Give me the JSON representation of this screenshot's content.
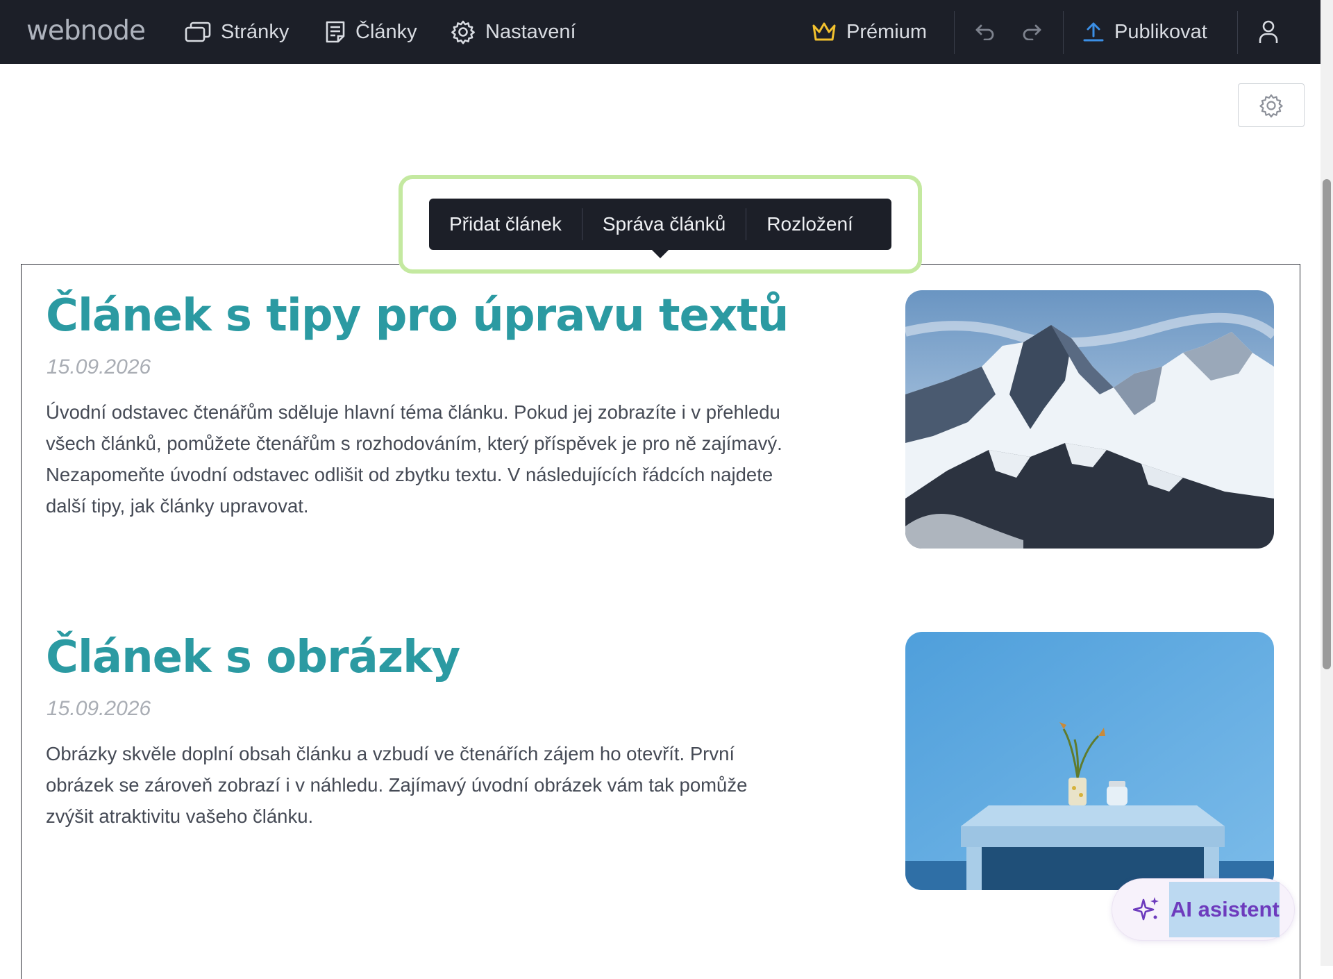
{
  "topbar": {
    "logo": "webnode",
    "nav": [
      {
        "label": "Stránky",
        "icon": "pages-icon"
      },
      {
        "label": "Články",
        "icon": "articles-icon"
      },
      {
        "label": "Nastavení",
        "icon": "gear-icon"
      }
    ],
    "premium_label": "Prémium",
    "publish_label": "Publikovat",
    "colors": {
      "bar": "#1c1f28",
      "crown": "#f2c12e",
      "publish_icon": "#3b8fe6"
    }
  },
  "toolbar": {
    "items": [
      "Přidat článek",
      "Správa článků",
      "Rozložení"
    ],
    "highlight_color": "#c4e9a0"
  },
  "articles": [
    {
      "title": "Článek s tipy pro úpravu textů",
      "date": "15.09.2026",
      "lines": [
        "Úvodní odstavec čtenářům sděluje hlavní téma článku. Pokud jej zobrazíte i v přehledu",
        "všech článků, pomůžete čtenářům s rozhodováním, který příspěvek je pro ně zajímavý.",
        "Nezapomeňte úvodní odstavec odlišit od zbytku textu. V následujících řádcích najdete",
        "další tipy, jak články upravovat."
      ],
      "image": "mountain-photo"
    },
    {
      "title": "Článek s obrázky",
      "date": "15.09.2026",
      "lines": [
        "Obrázky skvěle doplní obsah článku a vzbudí ve čtenářích zájem ho otevřít. První",
        "obrázek se zároveň zobrazí i v náhledu. Zajímavý úvodní obrázek vám tak pomůže",
        "zvýšit atraktivitu vašeho článku."
      ],
      "image": "blue-wall-table-photo"
    }
  ],
  "ai": {
    "label": "AI asistent",
    "accent": "#6d3bbd"
  },
  "title_color": "#2b9aa2"
}
